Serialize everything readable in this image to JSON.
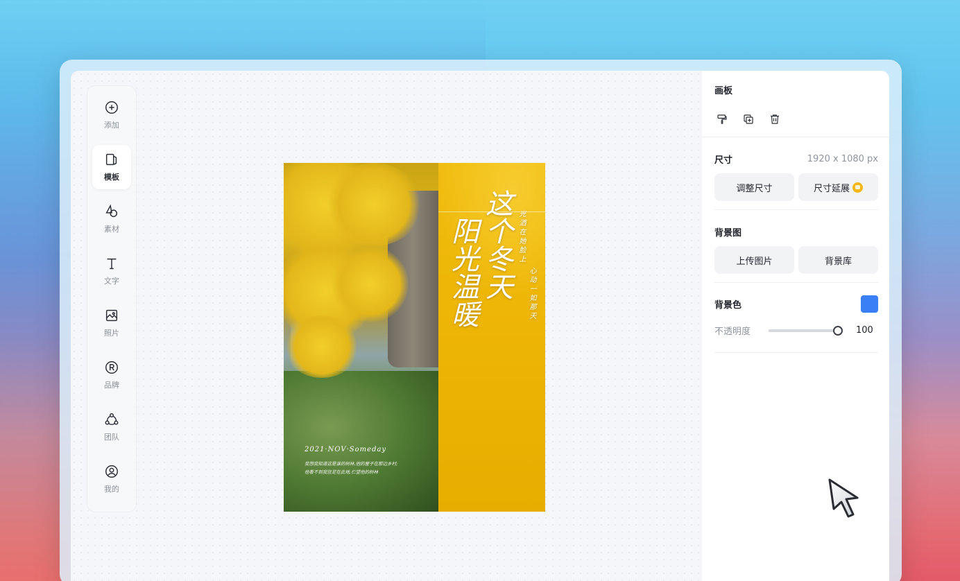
{
  "toolbar": {
    "items": [
      {
        "label": "添加",
        "icon": "plus-circle-icon",
        "active": false
      },
      {
        "label": "模板",
        "icon": "template-icon",
        "active": true
      },
      {
        "label": "素材",
        "icon": "shapes-icon",
        "active": false
      },
      {
        "label": "文字",
        "icon": "text-icon",
        "active": false
      },
      {
        "label": "照片",
        "icon": "image-icon",
        "active": false
      },
      {
        "label": "品牌",
        "icon": "registered-icon",
        "active": false
      },
      {
        "label": "团队",
        "icon": "team-icon",
        "active": false
      },
      {
        "label": "我的",
        "icon": "user-circle-icon",
        "active": false
      }
    ]
  },
  "poster": {
    "title_a": "这个冬天",
    "title_b": "阳光温暖",
    "subtitle_a": "光洒在她脸上",
    "subtitle_b": "心动一如那天",
    "date": "2021·NOV·Someday",
    "line1": "我想我知道这是谁的树林,他的屋子在那边乡村;",
    "line2": "他看不到我驻足在此地,伫望他的树林"
  },
  "panel": {
    "board_title": "画板",
    "size_title": "尺寸",
    "size_value": "1920 x 1080 px",
    "resize_btn": "调整尺寸",
    "extend_btn": "尺寸延展",
    "bg_image_title": "背景图",
    "upload_btn": "上传图片",
    "library_btn": "背景库",
    "bg_color_title": "背景色",
    "bg_color": "#3a7ff6",
    "opacity_label": "不透明度",
    "opacity_value": "100"
  }
}
